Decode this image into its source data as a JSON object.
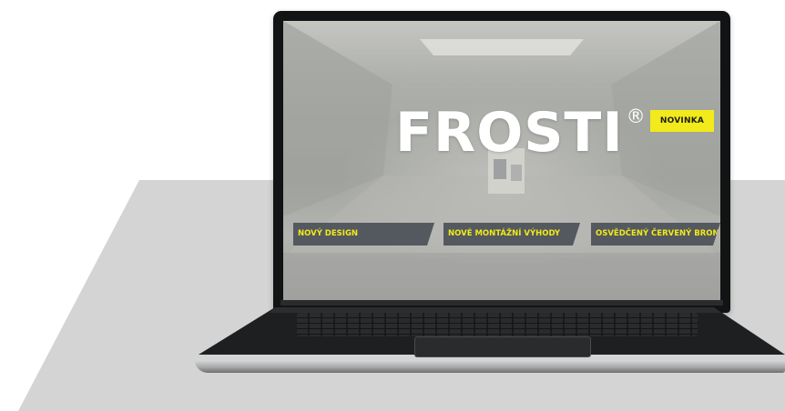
{
  "product": {
    "title": "FROSTI",
    "registered_mark": "®",
    "badge": "NOVINKA"
  },
  "features": [
    {
      "label": "NOVÝ DESIGN"
    },
    {
      "label": "NOVÉ MONTÁŽNÍ VÝHODY"
    },
    {
      "label": "OSVĚDČENÝ ČERVENÝ BRONZ"
    }
  ],
  "colors": {
    "accent_yellow": "#f2ea1a",
    "panel_gray": "#54585f",
    "floor_gray": "#d3d4d3",
    "laptop_black": "#121314"
  }
}
